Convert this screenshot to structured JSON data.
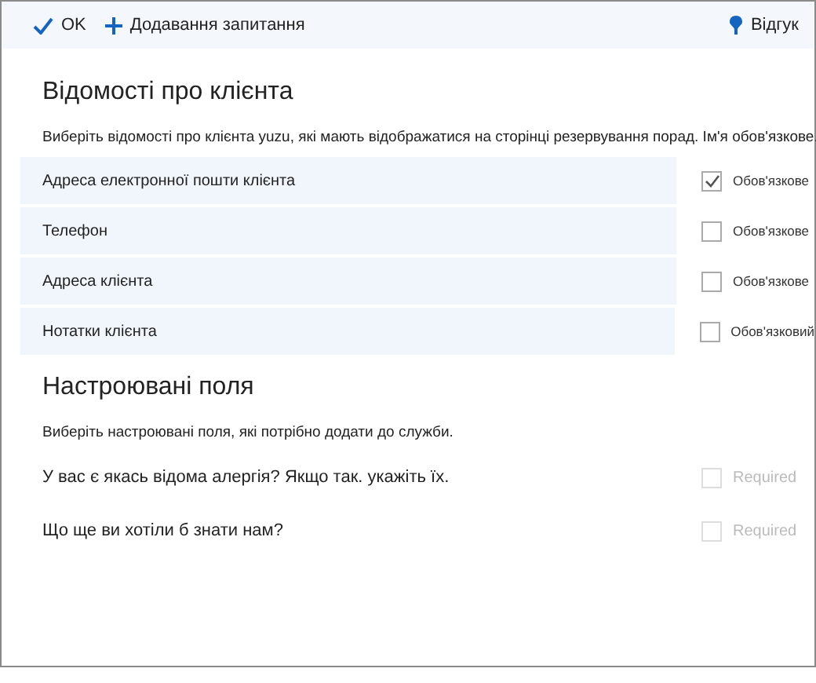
{
  "toolbar": {
    "ok": "OK",
    "add_question": "Додавання запитання",
    "feedback": "Відгук"
  },
  "customer_info": {
    "title": "Відомості про клієнта",
    "description": "Виберіть відомості про клієнта yuzu, які мають відображатися на сторінці резервування порад. Ім'я обов'язкове.",
    "fields": [
      {
        "label": "Адреса електронної пошти клієнта",
        "required_label": "Обов'язкове",
        "checked": true,
        "disabled": false
      },
      {
        "label": "Телефон",
        "required_label": "Обов'язкове",
        "checked": false,
        "disabled": false
      },
      {
        "label": "Адреса клієнта",
        "required_label": "Обов'язкове",
        "checked": false,
        "disabled": false
      },
      {
        "label": "Нотатки клієнта",
        "required_label": "Обов'язковий",
        "checked": false,
        "disabled": false
      }
    ]
  },
  "custom_fields": {
    "title": "Настроювані поля",
    "description": "Виберіть настроювані поля, які потрібно додати до служби.",
    "fields": [
      {
        "label": "У вас є якась відома алергія? Якщо так. укажіть їх.",
        "required_label": "Required",
        "checked": false,
        "disabled": true
      },
      {
        "label": "Що ще ви хотіли б знати нам?",
        "required_label": "Required",
        "checked": false,
        "disabled": true
      }
    ]
  }
}
